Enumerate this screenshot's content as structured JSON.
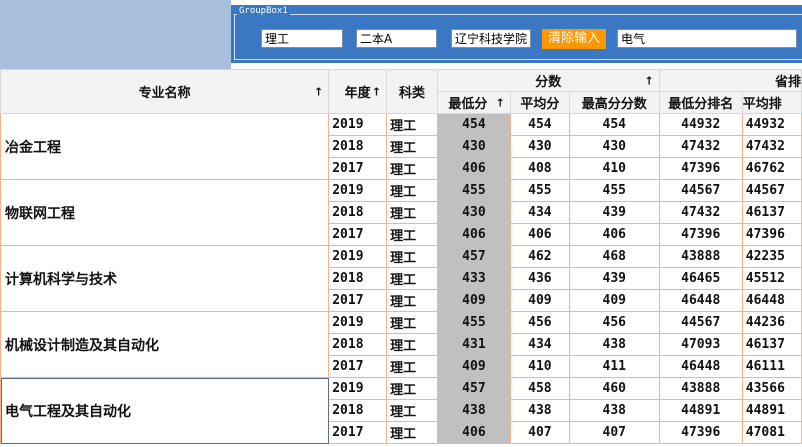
{
  "groupbox": {
    "title": "GroupBox1",
    "category_value": "理工",
    "batch_value": "二本A",
    "school_value": "辽宁科技学院",
    "clear_label": "清除输入",
    "major_filter_value": "电气"
  },
  "table": {
    "headers": {
      "major": "专业名称",
      "year": "年度",
      "kelei": "科类",
      "score_group": "分数",
      "rank_group": "省排",
      "min_score": "最低分",
      "avg_score": "平均分",
      "max_score": "最高分分数",
      "min_rank": "最低分排名",
      "avg_rank": "平均排"
    },
    "majors": [
      {
        "name": "冶金工程",
        "rows": [
          {
            "year": "2019",
            "kelei": "理工",
            "min": "454",
            "avg": "454",
            "max": "454",
            "min_rank": "44932",
            "avg_rank": "44932"
          },
          {
            "year": "2018",
            "kelei": "理工",
            "min": "430",
            "avg": "430",
            "max": "430",
            "min_rank": "47432",
            "avg_rank": "47432"
          },
          {
            "year": "2017",
            "kelei": "理工",
            "min": "406",
            "avg": "408",
            "max": "410",
            "min_rank": "47396",
            "avg_rank": "46762"
          }
        ]
      },
      {
        "name": "物联网工程",
        "rows": [
          {
            "year": "2019",
            "kelei": "理工",
            "min": "455",
            "avg": "455",
            "max": "455",
            "min_rank": "44567",
            "avg_rank": "44567"
          },
          {
            "year": "2018",
            "kelei": "理工",
            "min": "430",
            "avg": "434",
            "max": "439",
            "min_rank": "47432",
            "avg_rank": "46137"
          },
          {
            "year": "2017",
            "kelei": "理工",
            "min": "406",
            "avg": "406",
            "max": "406",
            "min_rank": "47396",
            "avg_rank": "47396"
          }
        ]
      },
      {
        "name": "计算机科学与技术",
        "rows": [
          {
            "year": "2019",
            "kelei": "理工",
            "min": "457",
            "avg": "462",
            "max": "468",
            "min_rank": "43888",
            "avg_rank": "42235"
          },
          {
            "year": "2018",
            "kelei": "理工",
            "min": "433",
            "avg": "436",
            "max": "439",
            "min_rank": "46465",
            "avg_rank": "45512"
          },
          {
            "year": "2017",
            "kelei": "理工",
            "min": "409",
            "avg": "409",
            "max": "409",
            "min_rank": "46448",
            "avg_rank": "46448"
          }
        ]
      },
      {
        "name": "机械设计制造及其自动化",
        "rows": [
          {
            "year": "2019",
            "kelei": "理工",
            "min": "455",
            "avg": "456",
            "max": "456",
            "min_rank": "44567",
            "avg_rank": "44236"
          },
          {
            "year": "2018",
            "kelei": "理工",
            "min": "431",
            "avg": "434",
            "max": "438",
            "min_rank": "47093",
            "avg_rank": "46137"
          },
          {
            "year": "2017",
            "kelei": "理工",
            "min": "409",
            "avg": "410",
            "max": "411",
            "min_rank": "46448",
            "avg_rank": "46111"
          }
        ]
      },
      {
        "name": "电气工程及其自动化",
        "rows": [
          {
            "year": "2019",
            "kelei": "理工",
            "min": "457",
            "avg": "458",
            "max": "460",
            "min_rank": "43888",
            "avg_rank": "43566"
          },
          {
            "year": "2018",
            "kelei": "理工",
            "min": "438",
            "avg": "438",
            "max": "438",
            "min_rank": "44891",
            "avg_rank": "44891"
          },
          {
            "year": "2017",
            "kelei": "理工",
            "min": "406",
            "avg": "407",
            "max": "407",
            "min_rank": "47396",
            "avg_rank": "47081"
          }
        ]
      }
    ]
  }
}
